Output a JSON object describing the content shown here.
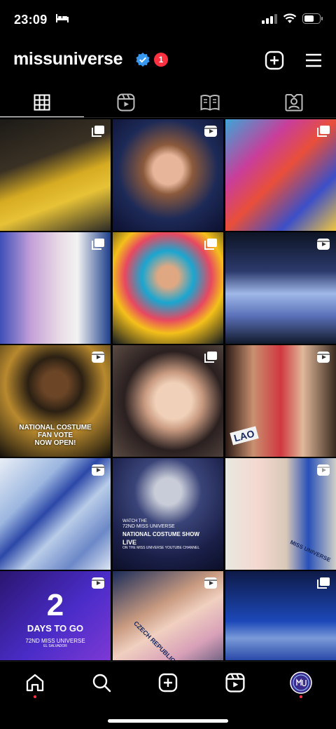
{
  "status": {
    "time": "23:09"
  },
  "profile": {
    "username": "missuniverse",
    "notification_count": "1"
  },
  "tabs": [
    "posts",
    "reels",
    "guides",
    "tagged"
  ],
  "grid": {
    "captions": {
      "post9_line1": "NATIONAL COSTUME",
      "post9_line2": "FAN VOTE",
      "post9_line3": "NOW OPEN!",
      "post14_watch": "WATCH THE",
      "post14_brand": "72ND MISS UNIVERSE",
      "post14_title": "NATIONAL COSTUME SHOW",
      "post14_live": "LIVE",
      "post14_channel": "ON THE MISS UNIVERSE YOUTUBE CHANNEL",
      "post16_number": "2",
      "post16_days": "DAYS TO GO",
      "post16_brand": "72ND MISS UNIVERSE",
      "post16_country": "EL SALVADOR",
      "post12_sash": "LAO",
      "post17_sash": "CZECH REPUBLIC",
      "post15_sash": "MISS UNIVERSE"
    }
  },
  "colors": {
    "accent_red": "#ff3040",
    "verified_blue": "#3897f0"
  }
}
